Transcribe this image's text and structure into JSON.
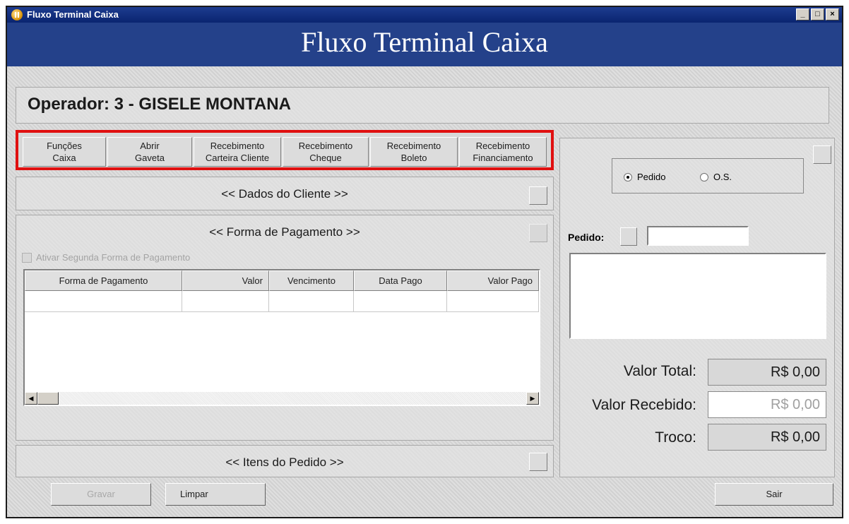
{
  "window": {
    "title": "Fluxo Terminal Caixa",
    "controls": [
      "_",
      "□",
      "×"
    ]
  },
  "banner": {
    "title": "Fluxo Terminal Caixa"
  },
  "operator": {
    "label": "Operador:  3 - GISELE MONTANA"
  },
  "toolbar": {
    "buttons": [
      {
        "label": "Funções\nCaixa"
      },
      {
        "label": "Abrir\nGaveta"
      },
      {
        "label": "Recebimento\nCarteira Cliente"
      },
      {
        "label": "Recebimento\nCheque"
      },
      {
        "label": "Recebimento\nBoleto"
      },
      {
        "label": "Recebimento\nFinanciamento"
      }
    ]
  },
  "sections": {
    "dados_cliente": "<< Dados do Cliente >>",
    "forma_pagamento": "<< Forma de Pagamento >>",
    "itens_pedido": "<< Itens do Pedido >>"
  },
  "payment": {
    "second_form_checkbox": "Ativar Segunda Forma de Pagamento",
    "columns": [
      "Forma de Pagamento",
      "Valor",
      "Vencimento",
      "Data Pago",
      "Valor Pago"
    ]
  },
  "order_type": {
    "options": [
      "Pedido",
      "O.S."
    ],
    "selected": "Pedido"
  },
  "pedido": {
    "label": "Pedido:",
    "value": ""
  },
  "totals": {
    "valor_total_label": "Valor Total:",
    "valor_total": "R$ 0,00",
    "valor_recebido_label": "Valor Recebido:",
    "valor_recebido": "R$ 0,00",
    "troco_label": "Troco:",
    "troco": "R$ 0,00"
  },
  "actions": {
    "gravar": "Gravar",
    "limpar": "Limpar",
    "sair": "Sair"
  }
}
